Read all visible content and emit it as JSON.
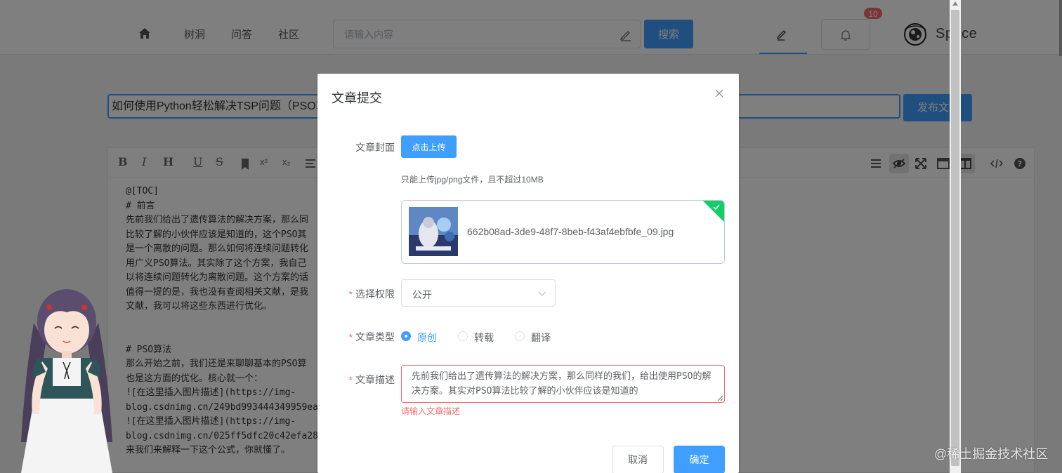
{
  "nav": {
    "links": [
      "树洞",
      "问答",
      "社区"
    ],
    "search_placeholder": "请输入内容",
    "search_button": "搜索",
    "notification_count": "10",
    "logo_text": "Space"
  },
  "editor": {
    "title_value": "如何使用Python轻松解决TSP问题（PSO算法",
    "publish_button": "发布文章",
    "toolbar_left": [
      "B",
      "I",
      "H",
      "U",
      "S",
      "x²",
      "x₂"
    ],
    "content": "@[TOC]\n# 前言\n先前我们给出了遗传算法的解决方案，那么同\n比较了解的小伙伴应该是知道的，这个PSO其\n是一个离散的问题。那么如何将连续问题转化\n用广义PSO算法。其实除了这个方案，我自己\n以将连续问题转化为离散问题。这个方案的话\n值得一提的是，我也没有查阅相关文献，是我\n文献，我可以将这些东西进行优化。\n\n\n# PSO算法\n那么开始之前，我们还是来聊聊基本的PSO算\n也是这方面的优化。核心就一个：\n![在这里插入图片描述](https://img-\nblog.csdnimg.cn/249bd993444349959ea2\n![在这里插入图片描述](https://img-\nblog.csdnimg.cn/025ff5dfc20c42efa282\n来我们来解释一下这个公式，你就懂了。"
  },
  "modal": {
    "title": "文章提交",
    "cover_label": "文章封面",
    "upload_button": "点击上传",
    "upload_tip": "只能上传jpg/png文件，且不超过10MB",
    "file_name": "662b08ad-3de9-48f7-8beb-f43af4ebfbfe_09.jpg",
    "permission_label": "选择权限",
    "permission_value": "公开",
    "type_label": "文章类型",
    "type_options": [
      "原创",
      "转载",
      "翻译"
    ],
    "type_selected": "原创",
    "desc_label": "文章描述",
    "desc_value": "先前我们给出了遗传算法的解决方案，那么同样的我们，给出使用PSO的解决方案。其实对PSO算法比较了解的小伙伴应该是知道的",
    "desc_error": "请输入文章描述",
    "cancel_button": "取消",
    "confirm_button": "确定"
  },
  "watermark": "@稀土掘金技术社区",
  "colors": {
    "primary": "#409eff",
    "danger": "#f56c6c",
    "success": "#13ce66"
  }
}
